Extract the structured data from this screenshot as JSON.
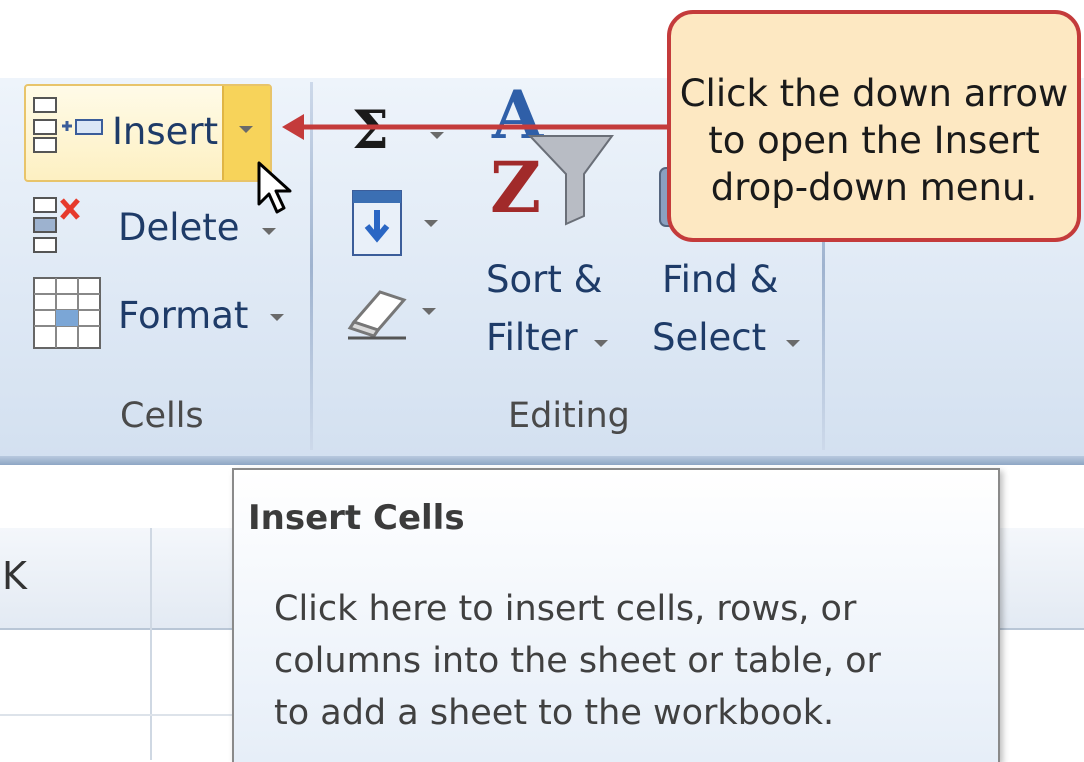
{
  "ribbon": {
    "cells_group": {
      "label": "Cells",
      "insert_label": "Insert",
      "delete_label": "Delete",
      "format_label": "Format"
    },
    "editing_group": {
      "label": "Editing",
      "sum_label": "Σ",
      "sort_filter_line1": "Sort &",
      "sort_filter_line2": "Filter",
      "find_select_line1": "Find &",
      "find_select_line2": "Select"
    }
  },
  "callout": {
    "text_lines": [
      "Click the down arrow",
      "to open the Insert",
      "drop-down menu."
    ]
  },
  "tooltip": {
    "title": "Insert Cells",
    "body_lines": [
      "Click here to insert cells, rows, or",
      "columns into the sheet or table, or",
      "to add a sheet to the workbook."
    ]
  },
  "sheet": {
    "column_header_k": "K"
  },
  "colors": {
    "callout_fill": "#fde8c2",
    "callout_border": "#c43b3b",
    "arrow": "#c43b3b",
    "ribbon_text": "#1e3b68",
    "hover_highlight": "#f7d35a"
  }
}
